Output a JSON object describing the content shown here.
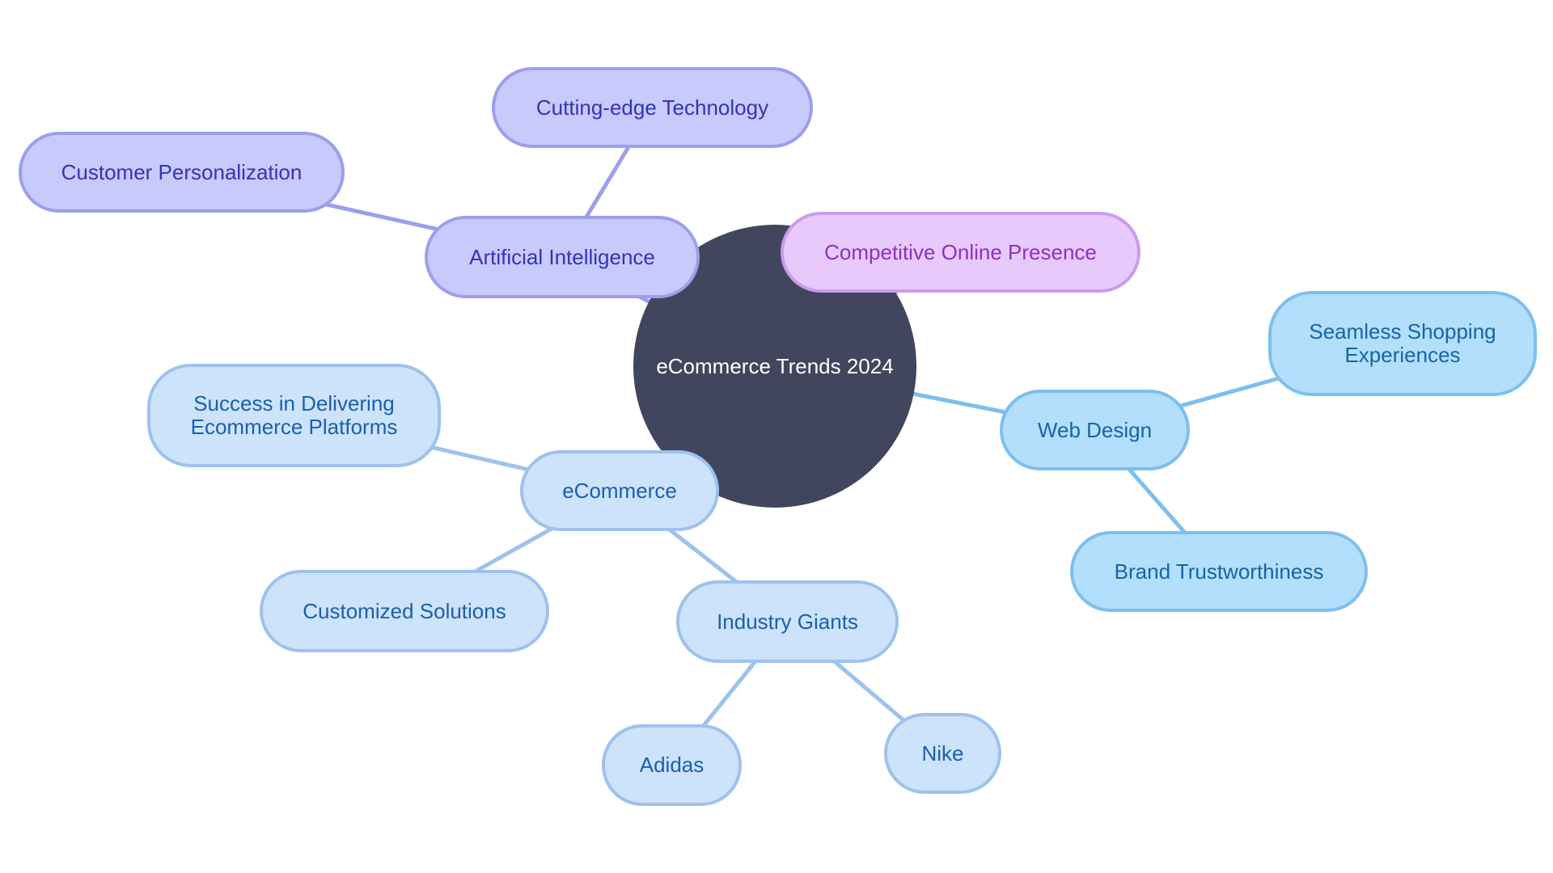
{
  "mindmap": {
    "root": {
      "id": "root",
      "label": "eCommerce Trends 2024",
      "fill": "#41465e",
      "text": "#ffffff"
    },
    "palettes": {
      "indigo": {
        "fill": "#c8cafc",
        "border": "#9c9fec",
        "text": "#3134b8"
      },
      "purple": {
        "fill": "#e8c9fc",
        "border": "#c99cee",
        "text": "#8d2fc4"
      },
      "sky": {
        "fill": "#b3dffc",
        "border": "#7dbfee",
        "text": "#1565a8"
      },
      "blue": {
        "fill": "#cde3fb",
        "border": "#9dc2ee",
        "text": "#1a5fb0"
      }
    },
    "nodes": [
      {
        "id": "ai",
        "label": "Artificial Intelligence",
        "parent": "root",
        "palette": "indigo"
      },
      {
        "id": "customer-personalization",
        "label": "Customer Personalization",
        "parent": "ai",
        "palette": "indigo"
      },
      {
        "id": "cutting-edge-technology",
        "label": "Cutting-edge Technology",
        "parent": "ai",
        "palette": "indigo"
      },
      {
        "id": "competitive-online-presence",
        "label": "Competitive Online Presence",
        "parent": "root",
        "palette": "purple"
      },
      {
        "id": "web-design",
        "label": "Web Design",
        "parent": "root",
        "palette": "sky"
      },
      {
        "id": "seamless-shopping",
        "label": "Seamless Shopping\nExperiences",
        "parent": "web-design",
        "palette": "sky"
      },
      {
        "id": "brand-trustworthiness",
        "label": "Brand Trustworthiness",
        "parent": "web-design",
        "palette": "sky"
      },
      {
        "id": "ecommerce",
        "label": "eCommerce",
        "parent": "root",
        "palette": "blue"
      },
      {
        "id": "success-delivering",
        "label": "Success in Delivering\nEcommerce Platforms",
        "parent": "ecommerce",
        "palette": "blue"
      },
      {
        "id": "customized-solutions",
        "label": "Customized Solutions",
        "parent": "ecommerce",
        "palette": "blue"
      },
      {
        "id": "industry-giants",
        "label": "Industry Giants",
        "parent": "ecommerce",
        "palette": "blue"
      },
      {
        "id": "adidas",
        "label": "Adidas",
        "parent": "industry-giants",
        "palette": "blue"
      },
      {
        "id": "nike",
        "label": "Nike",
        "parent": "industry-giants",
        "palette": "blue"
      }
    ]
  }
}
